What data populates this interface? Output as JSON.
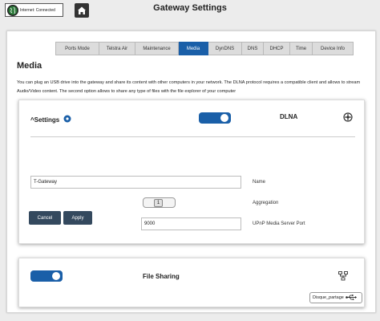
{
  "header": {
    "status": "Internet: Connected",
    "title": "Gateway Settings"
  },
  "tabs": [
    {
      "label": "Ports Mode"
    },
    {
      "label": "Telstra Air"
    },
    {
      "label": "Maintenance"
    },
    {
      "label": "Media",
      "active": true
    },
    {
      "label": "DynDNS"
    },
    {
      "label": "DNS"
    },
    {
      "label": "DHCP"
    },
    {
      "label": "Time"
    },
    {
      "label": "Device Info"
    }
  ],
  "media": {
    "title": "Media",
    "description": "You can plug an USB drive into the gateway and share its content with other computers in your network. The DLNA protocol requires a compatible client and allows to stream Audio/Video content. The second option allows to share any type of files with the file explorer of your computer"
  },
  "dlna": {
    "settings_label": "^Settings",
    "label": "DLNA",
    "enabled": true,
    "device_name_value": "T-Gateway",
    "device_name_label": "Name",
    "aggregation_label": "Aggregation",
    "aggregation_value": "1",
    "port_value": "9000",
    "port_label": "UPnP Media Server Port",
    "cancel_label": "Cancel",
    "apply_label": "Apply"
  },
  "file_sharing": {
    "label": "File Sharing",
    "enabled": true,
    "share_name": "Disque_partage"
  },
  "colors": {
    "accent": "#1a5fa8",
    "button_dark": "#34495e"
  }
}
